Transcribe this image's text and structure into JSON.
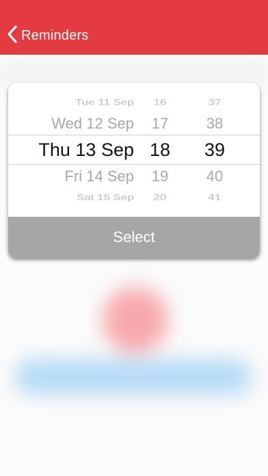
{
  "navbar": {
    "back_label": "Reminders",
    "color": "#e33b41"
  },
  "picker": {
    "rows": [
      {
        "date": "Tue 11 Sep",
        "hour": "16",
        "minute": "37"
      },
      {
        "date": "Wed 12 Sep",
        "hour": "17",
        "minute": "38"
      },
      {
        "date": "Thu 13 Sep",
        "hour": "18",
        "minute": "39"
      },
      {
        "date": "Fri 14 Sep",
        "hour": "19",
        "minute": "40"
      },
      {
        "date": "Sat 15 Sep",
        "hour": "20",
        "minute": "41"
      }
    ],
    "select_label": "Select"
  }
}
